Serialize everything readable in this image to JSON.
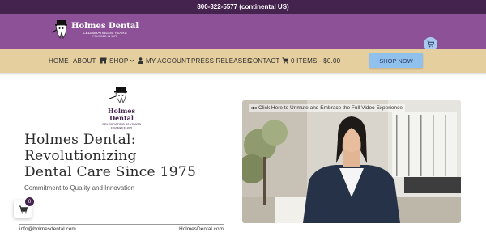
{
  "topbar": {
    "phone_text": "800-322-5577 (continental US)"
  },
  "brand": {
    "name": "Holmes Dental",
    "tagline_line1": "CELEBRATING 50 YEARS",
    "tagline_line2": "FOUNDED IN 1975"
  },
  "nav": {
    "items": [
      {
        "label": "HOME"
      },
      {
        "label": "ABOUT"
      },
      {
        "label": "SHOP"
      },
      {
        "label": "MY ACCOUNT"
      },
      {
        "label": "PRESS RELEASES"
      },
      {
        "label": "CONTACT"
      },
      {
        "label": "0 ITEMS - $0.00"
      }
    ],
    "shop_now": "SHOP NOW"
  },
  "hero": {
    "headline_line1": "Holmes Dental:",
    "headline_line2": "Revolutionizing",
    "headline_line3": "Dental Care Since 1975",
    "tagline": "Commitment to Quality and Innovation"
  },
  "video": {
    "caption": "Click Here to Unmute and Embrace the Full Video Experience"
  },
  "footer_strip": {
    "email": "info@holmesdental.com",
    "site": "HolmesDental.com"
  },
  "floating_cart": {
    "count": "0"
  },
  "colors": {
    "topbar": "#45234f",
    "header": "#8c5196",
    "nav": "#e6cf9f",
    "accent": "#8fc1ec"
  }
}
